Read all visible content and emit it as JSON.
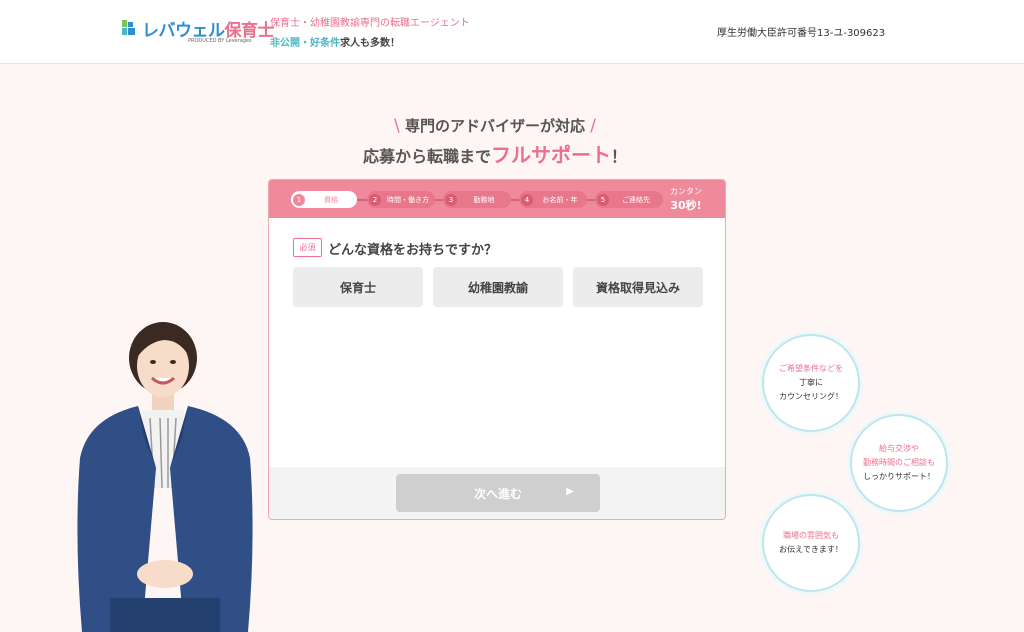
{
  "header": {
    "logo_brand": "レバウェル",
    "logo_accent": "保育士",
    "logo_sub": "PRODUCED BY Leverages",
    "tagline_1": "保育士・幼稚園教諭専門の転職エージェント",
    "tagline_2_highlight": "非公開・好条件",
    "tagline_2_rest": "求人も多数！",
    "license": "厚生労働大臣許可番号13-ユ-309623"
  },
  "headline": {
    "line1": "専門のアドバイザーが対応",
    "line2_pre": "応募から転職まで",
    "line2_accent": "フルサポート",
    "line2_post": "！"
  },
  "steps": [
    {
      "num": "1",
      "label": "資格"
    },
    {
      "num": "2",
      "label": "時間・働き方"
    },
    {
      "num": "3",
      "label": "勤務地"
    },
    {
      "num": "4",
      "label": "お名前・年"
    },
    {
      "num": "5",
      "label": "ご連絡先"
    }
  ],
  "quick": {
    "line1": "カンタン",
    "line2": "30秒!"
  },
  "question": {
    "required_badge": "必須",
    "text": "どんな資格をお持ちですか？"
  },
  "options": [
    "保育士",
    "幼稚園教諭",
    "資格取得見込み"
  ],
  "next_button": {
    "label": "次へ進む",
    "arrow": "▶"
  },
  "bubbles": [
    {
      "l1": "ご希望条件などを",
      "l2": "丁寧に",
      "l3": "カウンセリング！"
    },
    {
      "l1": "給与交渉や",
      "l2": "勤務時間のご相談も",
      "l3": "しっかりサポート！"
    },
    {
      "l1": "職場の雰囲気も",
      "l2": "お伝えできます！",
      "l3": ""
    }
  ],
  "colors": {
    "pink": "#ec6f8d",
    "step_bar": "#ee8a9c",
    "teal": "#4ab8c6",
    "blue": "#2e8fd0"
  }
}
